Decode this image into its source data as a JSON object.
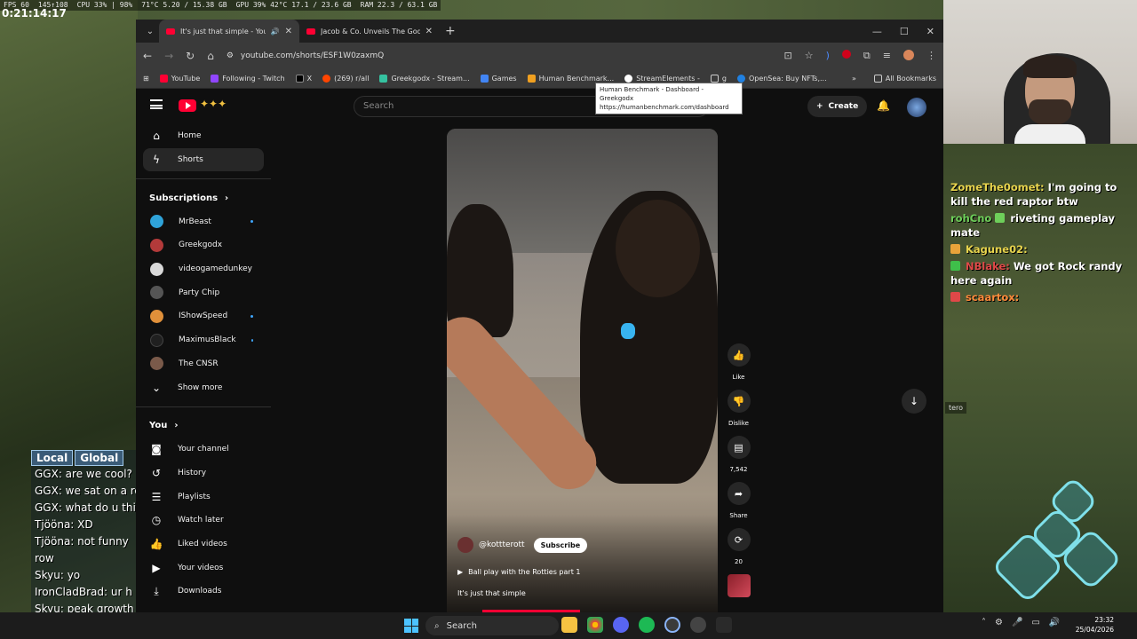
{
  "overlay": {
    "stats": [
      "FPS 60",
      "145↑108",
      "CPU 33% | 98%",
      "71°C 5.20 / 15.38 GB",
      "GPU 39% 42°C 17.1 / 23.6 GB",
      "RAM 22.3 / 63.1 GB"
    ],
    "game_clock": "0:21:14:17"
  },
  "browser": {
    "tabs": [
      {
        "title": "It's just that simple - YouTube"
      },
      {
        "title": "Jacob & Co. Unveils The Godfather"
      }
    ],
    "url": "youtube.com/shorts/ESF1W0zaxmQ",
    "bookmarks": [
      "YouTube",
      "Following - Twitch",
      "X",
      "(269) r/all",
      "Greekgodx - Stream...",
      "Games",
      "Human Benchmark...",
      "StreamElements -",
      "g",
      "OpenSea: Buy NFTs,..."
    ],
    "all_bookmarks": "All Bookmarks",
    "tooltip_title": "Human Benchmark - Dashboard - Greekgodx",
    "tooltip_url": "https://humanbenchmark.com/dashboard"
  },
  "youtube": {
    "search_placeholder": "Search",
    "create_label": "Create",
    "nav": [
      {
        "label": "Home",
        "icon": "home-icon"
      },
      {
        "label": "Shorts",
        "icon": "shorts-icon"
      }
    ],
    "subscriptions_title": "Subscriptions",
    "subscriptions": [
      {
        "label": "MrBeast",
        "live": true,
        "color": "#2fa3d9"
      },
      {
        "label": "Greekgodx",
        "live": false,
        "color": "#b33a3a"
      },
      {
        "label": "videogamedunkey",
        "live": true,
        "color": "#d9d9d9"
      },
      {
        "label": "Party Chip",
        "live": false,
        "color": "#555555"
      },
      {
        "label": "IShowSpeed",
        "live": true,
        "color": "#e0903a"
      },
      {
        "label": "MaximusBlack",
        "live": true,
        "color": "#202020"
      },
      {
        "label": "The CNSR",
        "live": false,
        "color": "#7a5a4a"
      }
    ],
    "show_more": "Show more",
    "you_title": "You",
    "you_items": [
      {
        "label": "Your channel",
        "icon": "channel-icon"
      },
      {
        "label": "History",
        "icon": "history-icon"
      },
      {
        "label": "Playlists",
        "icon": "playlists-icon"
      },
      {
        "label": "Watch later",
        "icon": "watch-later-icon"
      },
      {
        "label": "Liked videos",
        "icon": "like-icon"
      },
      {
        "label": "Your videos",
        "icon": "your-videos-icon"
      },
      {
        "label": "Downloads",
        "icon": "download-icon"
      }
    ],
    "short": {
      "channel": "@kottterott",
      "subscribe": "Subscribe",
      "playlist": "Ball play with the Rotties part 1",
      "caption": "It's just that simple",
      "progress": 0.36
    },
    "actions": {
      "like": "Like",
      "dislike": "Dislike",
      "comments": "7,542",
      "share": "Share",
      "remix": "20"
    }
  },
  "game_chat": {
    "tabs": [
      "Local",
      "Global"
    ],
    "lines": [
      "GGX:  are we cool?",
      "GGX:  we sat on a ro",
      "GGX:  what do u thi",
      "Tjööna:  XD",
      "Tjööna:  not funny",
      "           row",
      "Skyu:  yo",
      "IronCladBrad:  ur h",
      "Skyu:  peak growth"
    ]
  },
  "twitch_chat": [
    {
      "user": "ZomeThe0omet:",
      "text": "I'm going to kill the red raptor btw",
      "color": "yellow"
    },
    {
      "user": "rohCno",
      "text": "riveting gameplay mate",
      "color": "green"
    },
    {
      "user": "Kagune02:",
      "text": "",
      "color": "yellow"
    },
    {
      "user": "NBlake:",
      "text": "We got Rock randy here again",
      "color": "red"
    },
    {
      "user": "scaartox:",
      "text": "",
      "color": "orange"
    }
  ],
  "game_hud": {
    "player_tag": "tero"
  },
  "taskbar": {
    "search": "Search",
    "time": "23:32",
    "date": "25/04/2026"
  }
}
